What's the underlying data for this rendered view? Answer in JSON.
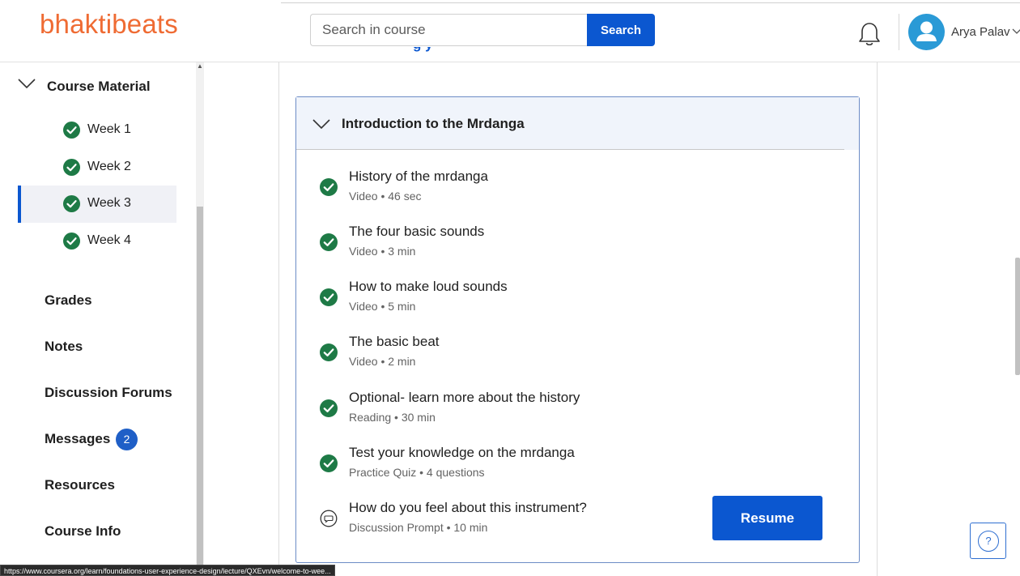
{
  "brand": {
    "logo": "bhaktibeats",
    "logo_color": "#ef6b33"
  },
  "search": {
    "placeholder": "Search in course",
    "button_label": "Search"
  },
  "user": {
    "name": "Arya Palav"
  },
  "sidebar": {
    "section_title": "Course Material",
    "weeks": [
      {
        "label": "Week 1",
        "completed": true,
        "active": false
      },
      {
        "label": "Week 2",
        "completed": true,
        "active": false
      },
      {
        "label": "Week 3",
        "completed": true,
        "active": true
      },
      {
        "label": "Week 4",
        "completed": true,
        "active": false
      }
    ],
    "nav": [
      {
        "label": "Grades"
      },
      {
        "label": "Notes"
      },
      {
        "label": "Discussion Forums"
      },
      {
        "label": "Messages",
        "badge": "2"
      },
      {
        "label": "Resources"
      },
      {
        "label": "Course Info"
      }
    ]
  },
  "module": {
    "title": "Introduction to the Mrdanga",
    "items": [
      {
        "title": "History of the mrdanga",
        "meta": "Video • 46 sec",
        "status": "completed"
      },
      {
        "title": "The four basic sounds",
        "meta": "Video • 3 min",
        "status": "completed"
      },
      {
        "title": "How to make loud sounds",
        "meta": "Video • 5 min",
        "status": "completed"
      },
      {
        "title": "The basic beat",
        "meta": "Video • 2 min",
        "status": "completed"
      },
      {
        "title": "Optional- learn more about the history",
        "meta": "Reading • 30 min",
        "status": "completed"
      },
      {
        "title": "Test your knowledge on the mrdanga",
        "meta": "Practice Quiz • 4 questions",
        "status": "completed"
      },
      {
        "title": "How do you feel about this instrument?",
        "meta": "Discussion Prompt • 10 min",
        "status": "pending"
      }
    ],
    "resume_label": "Resume"
  },
  "help": {
    "label": "?"
  },
  "status_bar": {
    "url": "https://www.coursera.org/learn/foundations-user-experience-design/lecture/QXEvn/welcome-to-wee..."
  },
  "colors": {
    "accent": "#0b57d0",
    "success": "#1e7a46",
    "badge": "#1f5fc7"
  }
}
